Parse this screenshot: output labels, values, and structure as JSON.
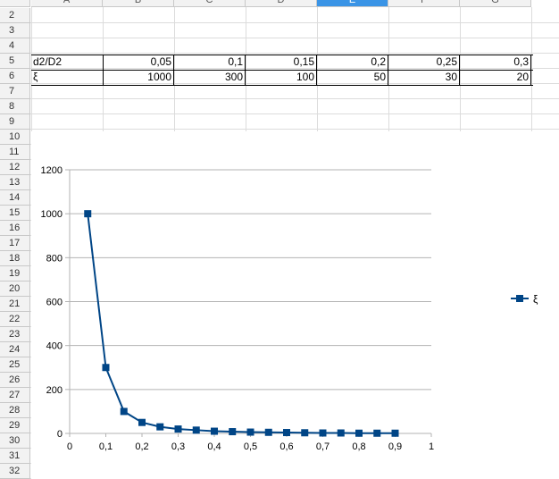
{
  "sheet": {
    "columns": [
      {
        "label": "A",
        "selected": false
      },
      {
        "label": "B",
        "selected": false
      },
      {
        "label": "C",
        "selected": false
      },
      {
        "label": "D",
        "selected": false
      },
      {
        "label": "E",
        "selected": true
      },
      {
        "label": "F",
        "selected": false
      },
      {
        "label": "G",
        "selected": false
      }
    ],
    "rows": [
      "2",
      "3",
      "4",
      "5",
      "6",
      "7",
      "8",
      "9",
      "10",
      "11",
      "12",
      "13",
      "14",
      "15",
      "16",
      "17",
      "18",
      "19",
      "20",
      "21",
      "22",
      "23",
      "24",
      "25",
      "26",
      "27",
      "28",
      "29",
      "30",
      "31",
      "32"
    ],
    "row5": {
      "label": "d2/D2",
      "values": [
        "0,05",
        "0,1",
        "0,15",
        "0,2",
        "0,25",
        "0,3"
      ]
    },
    "row6": {
      "label": "ξ",
      "values": [
        "1000",
        "300",
        "100",
        "50",
        "30",
        "20"
      ]
    },
    "selected_color": "#3a94e6"
  },
  "chart_data": {
    "type": "line",
    "series": [
      {
        "name": "ξ",
        "color": "#004586",
        "marker": "square",
        "x": [
          0.05,
          0.1,
          0.15,
          0.2,
          0.25,
          0.3,
          0.35,
          0.4,
          0.45,
          0.5,
          0.55,
          0.6,
          0.65,
          0.7,
          0.75,
          0.8,
          0.85,
          0.9
        ],
        "y": [
          1000,
          300,
          100,
          50,
          30,
          20,
          15,
          10,
          8,
          6,
          5,
          4,
          3,
          2,
          2,
          1,
          1,
          1
        ]
      }
    ],
    "xlim": [
      0,
      1
    ],
    "ylim": [
      0,
      1200
    ],
    "x_ticks": [
      "0",
      "0,1",
      "0,2",
      "0,3",
      "0,4",
      "0,5",
      "0,6",
      "0,7",
      "0,8",
      "0,9",
      "1"
    ],
    "y_ticks": [
      "0",
      "200",
      "400",
      "600",
      "800",
      "1000",
      "1200"
    ],
    "grid": "horizontal",
    "legend": "right"
  }
}
